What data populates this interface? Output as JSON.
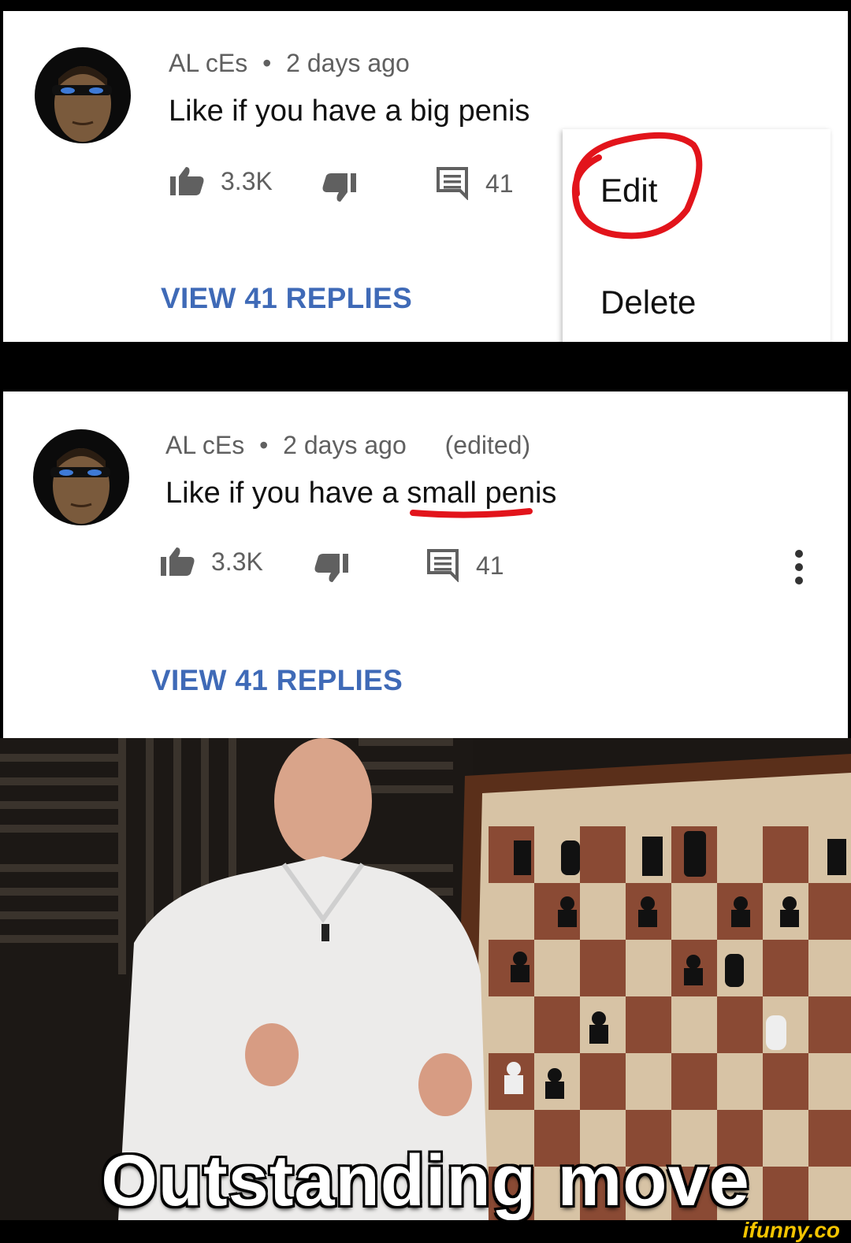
{
  "comment_before": {
    "author": "AL cEs",
    "separator": "•",
    "time": "2 days ago",
    "text": "Like if you have a big penis",
    "likes": "3.3K",
    "reply_count": "41",
    "view_replies": "VIEW 41 REPLIES",
    "menu": {
      "edit": "Edit",
      "delete": "Delete"
    }
  },
  "comment_after": {
    "author": "AL cEs",
    "separator": "•",
    "time": "2 days ago",
    "edited": "(edited)",
    "text_prefix": "Like if you have a ",
    "text_highlight": "small",
    "text_suffix": " penis",
    "likes": "3.3K",
    "reply_count": "41",
    "view_replies": "VIEW 41 REPLIES"
  },
  "meme": {
    "caption": "Outstanding move",
    "watermark": "ifunny.co"
  },
  "colors": {
    "link_blue": "#3f6ab7",
    "annotation_red": "#e2141b",
    "meta_gray": "#606060",
    "watermark_yellow": "#f4c400"
  },
  "icons": [
    "thumb-up-icon",
    "thumb-down-icon",
    "reply-comment-icon",
    "more-vert-icon"
  ]
}
